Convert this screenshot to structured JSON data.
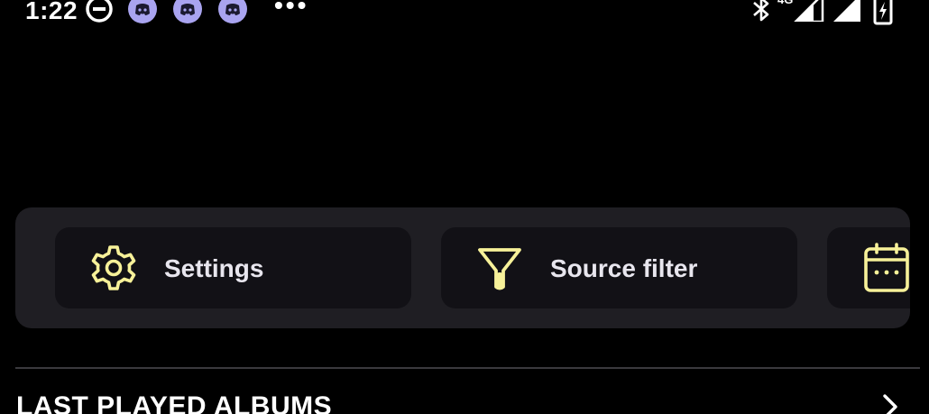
{
  "status_bar": {
    "time": "1:22",
    "more": "•••",
    "network": "4G",
    "icons": [
      "do-not-disturb-icon",
      "discord-icon",
      "discord-icon",
      "discord-icon",
      "bluetooth-icon",
      "signal-icon",
      "signal-icon",
      "battery-charging-icon"
    ]
  },
  "shortcuts": {
    "items": [
      {
        "label": "Settings",
        "icon": "gear-icon"
      },
      {
        "label": "Source filter",
        "icon": "filter-icon"
      },
      {
        "label": "",
        "icon": "calendar-icon"
      }
    ]
  },
  "section": {
    "title": "LAST PLAYED ALBUMS",
    "action_icon": "chevron-right-icon"
  },
  "colors": {
    "background": "#000000",
    "panel": "#1f1e23",
    "chip": "#121116",
    "accent_yellow": "#f7f199",
    "discord_purple": "#a9a4f0",
    "divider": "#3a393e"
  }
}
